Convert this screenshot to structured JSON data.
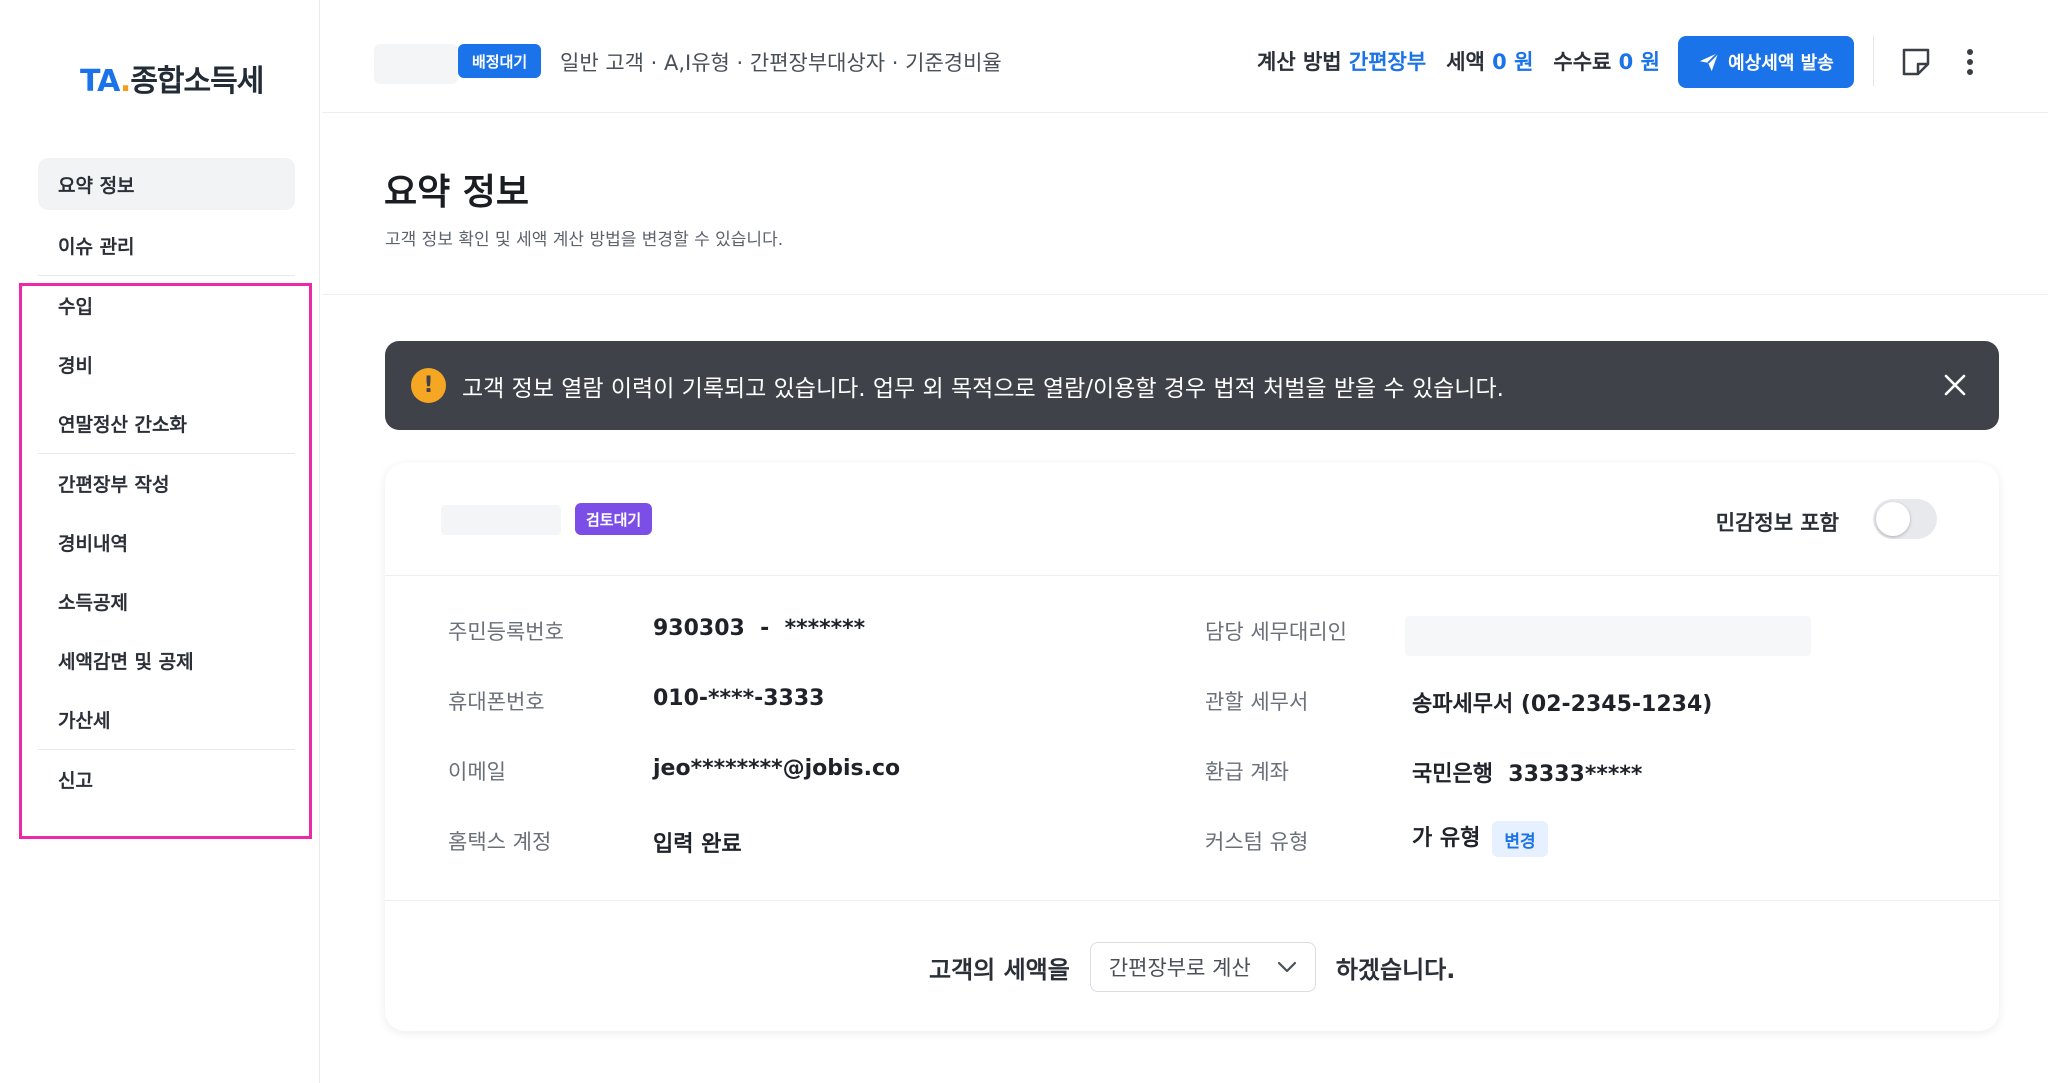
{
  "sidebar": {
    "logo": {
      "ta": "TA",
      "dot": ".",
      "rest": "종합소득세"
    },
    "items": [
      {
        "label": "요약 정보"
      },
      {
        "label": "이슈 관리"
      },
      {
        "label": "수입"
      },
      {
        "label": "경비"
      },
      {
        "label": "연말정산 간소화"
      },
      {
        "label": "간편장부 작성"
      },
      {
        "label": "경비내역"
      },
      {
        "label": "소득공제"
      },
      {
        "label": "세액감면 및 공제"
      },
      {
        "label": "가산세"
      },
      {
        "label": "신고"
      }
    ]
  },
  "header": {
    "assign_badge": "배정대기",
    "customer_info": "일반 고객 · A,I유형 · 간편장부대상자 · 기준경비율",
    "calc_label": "계산 방법",
    "calc_value": "간편장부",
    "tax_label": "세액",
    "tax_value": "0 원",
    "fee_label": "수수료",
    "fee_value": "0 원",
    "send_button": "예상세액 발송"
  },
  "page": {
    "title": "요약 정보",
    "subtitle": "고객 정보 확인 및 세액 계산 방법을 변경할 수 있습니다."
  },
  "alert": {
    "icon": "!",
    "text": "고객 정보 열람 이력이 기록되고 있습니다. 업무 외 목적으로 열람/이용할 경우 법적 처벌을 받을 수 있습니다."
  },
  "card": {
    "review_badge": "검토대기",
    "sensitive_label": "민감정보 포함",
    "fields": {
      "rrn_label": "주민등록번호",
      "rrn_value": "930303  -  *******",
      "phone_label": "휴대폰번호",
      "phone_value": "010-****-3333",
      "email_label": "이메일",
      "email_value": "jeo********@jobis.co",
      "hometax_label": "홈택스 계정",
      "hometax_value": "입력 완료",
      "agent_label": "담당 세무대리인",
      "office_label": "관할 세무서",
      "office_value": "송파세무서 (02-2345-1234)",
      "account_label": "환급 계좌",
      "account_value": "국민은행  33333*****",
      "custom_label": "커스텀 유형",
      "custom_value": "가 유형",
      "change_button": "변경"
    },
    "footer": {
      "prefix": "고객의 세액을",
      "select_value": "간편장부로 계산",
      "suffix": "하겠습니다."
    }
  },
  "colors": {
    "accent": "#1a73e8",
    "highlight": "#ec2aa8",
    "review": "#7b4ee8",
    "warning": "#f5a623"
  }
}
